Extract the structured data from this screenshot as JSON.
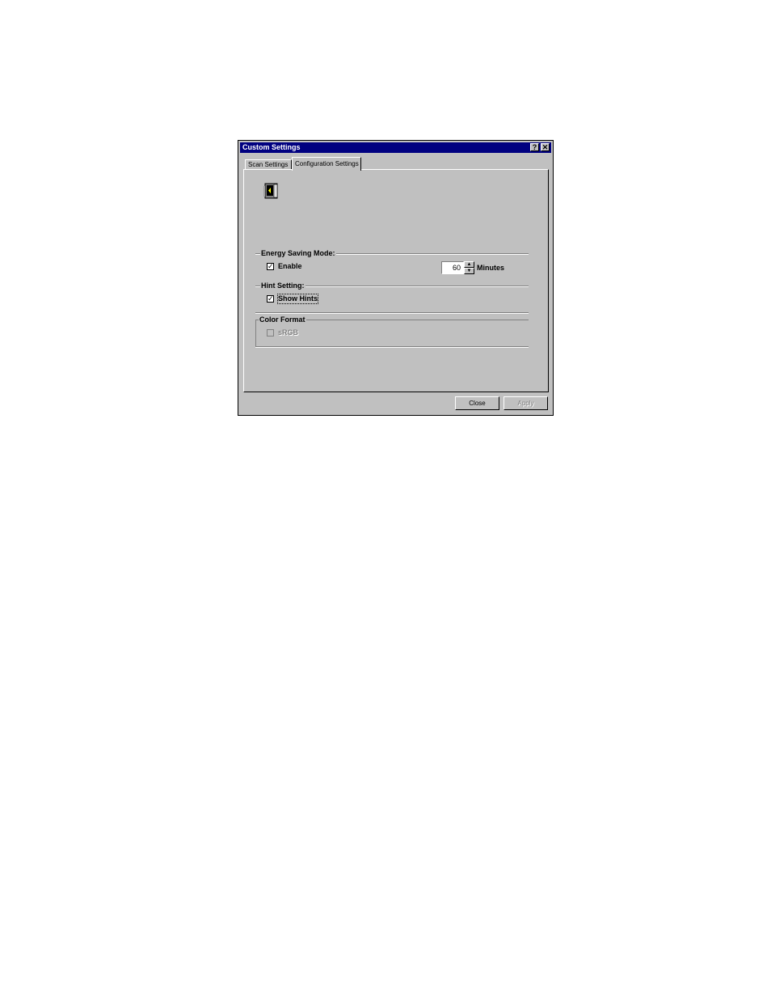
{
  "window": {
    "title": "Custom Settings",
    "help_glyph": "?",
    "close_glyph": "✕"
  },
  "tabs": [
    {
      "label": "Scan Settings",
      "active": false
    },
    {
      "label": "Configuration Settings",
      "active": true
    }
  ],
  "energy_saving": {
    "heading": "Energy Saving Mode:",
    "enable_label": "Enable",
    "enable_checked": true,
    "minutes_value": "60",
    "minutes_label": "Minutes"
  },
  "hint_setting": {
    "heading": "Hint Setting:",
    "show_hints_label": "Show Hints",
    "show_hints_checked": true
  },
  "color_format": {
    "heading": "Color Format",
    "srgb_label": "sRGB",
    "srgb_checked": false,
    "srgb_enabled": false
  },
  "buttons": {
    "close_label": "Close",
    "apply_label": "Apply"
  },
  "glyphs": {
    "check": "✓",
    "spin_up": "▲",
    "spin_down": "▼"
  },
  "icons": {
    "header": "scanner-icon"
  }
}
